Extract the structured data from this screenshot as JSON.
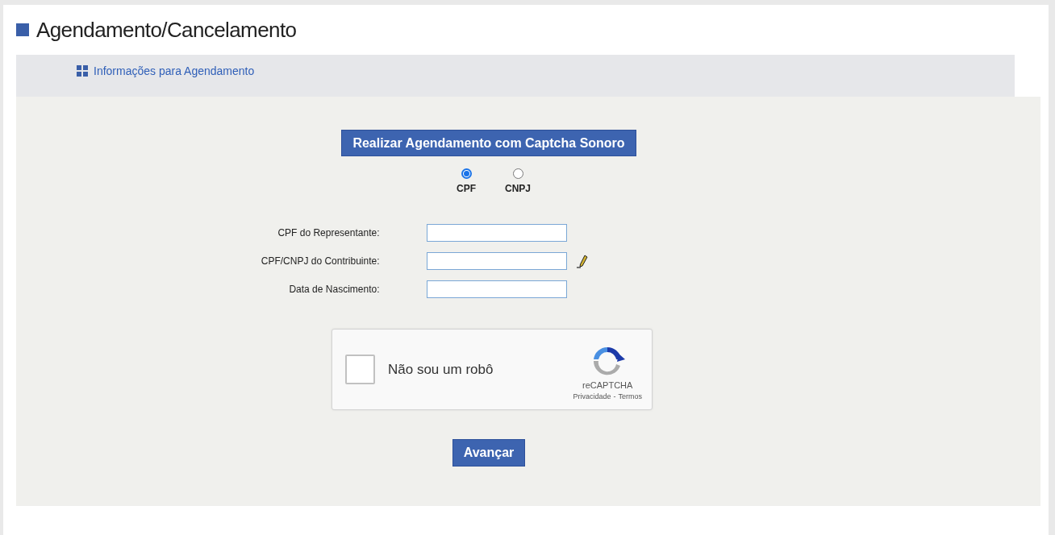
{
  "page_title": "Agendamento/Cancelamento",
  "info_link": "Informações para Agendamento",
  "audio_captcha_button": "Realizar Agendamento com Captcha Sonoro",
  "person_type": [
    {
      "label": "CPF",
      "selected": true
    },
    {
      "label": "CNPJ",
      "selected": false
    }
  ],
  "fields": [
    {
      "label": "CPF do Representante:",
      "edit_icon": false
    },
    {
      "label": "CPF/CNPJ do Contribuinte:",
      "edit_icon": true
    },
    {
      "label": "Data de Nascimento:",
      "edit_icon": false
    }
  ],
  "captcha": {
    "label": "Não sou um robô",
    "checked": false,
    "brand": "reCAPTCHA",
    "privacy_link": "Privacidade",
    "separator": "-",
    "terms_link": "Termos"
  },
  "submit_button": "Avançar"
}
